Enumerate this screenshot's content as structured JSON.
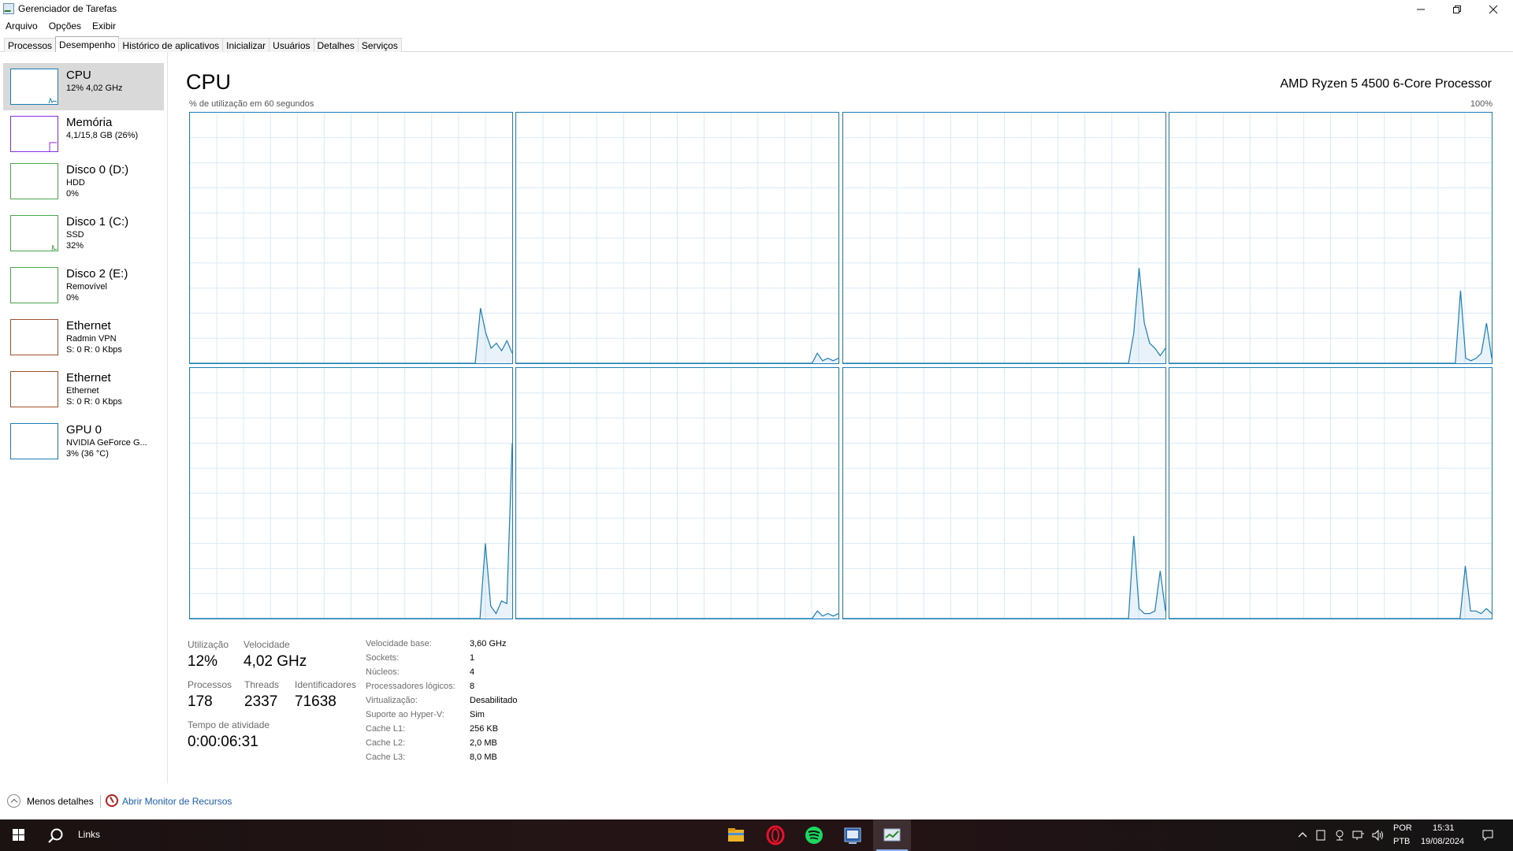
{
  "window": {
    "title": "Gerenciador de Tarefas",
    "minimize_icon": "minimize-icon",
    "maximize_icon": "restore-icon",
    "close_icon": "close-icon"
  },
  "menu": [
    "Arquivo",
    "Opções",
    "Exibir"
  ],
  "tabs": [
    {
      "label": "Processos",
      "active": false
    },
    {
      "label": "Desempenho",
      "active": true
    },
    {
      "label": "Histórico de aplicativos",
      "active": false
    },
    {
      "label": "Inicializar",
      "active": false
    },
    {
      "label": "Usuários",
      "active": false
    },
    {
      "label": "Detalhes",
      "active": false
    },
    {
      "label": "Serviços",
      "active": false
    }
  ],
  "sidebar": {
    "items": [
      {
        "name": "CPU",
        "line1": "12% 4,02 GHz",
        "line2": "",
        "color": "#1a7eb8",
        "selected": true
      },
      {
        "name": "Memória",
        "line1": "4,1/15,8 GB (26%)",
        "line2": "",
        "color": "#8a2be2",
        "selected": false
      },
      {
        "name": "Disco 0 (D:)",
        "line1": "HDD",
        "line2": "0%",
        "color": "#4ca64c",
        "selected": false
      },
      {
        "name": "Disco 1 (C:)",
        "line1": "SSD",
        "line2": "32%",
        "color": "#4ca64c",
        "selected": false
      },
      {
        "name": "Disco 2 (E:)",
        "line1": "Removível",
        "line2": "0%",
        "color": "#4ca64c",
        "selected": false
      },
      {
        "name": "Ethernet",
        "line1": "Radmin VPN",
        "line2": "S: 0 R: 0 Kbps",
        "color": "#a0522d",
        "selected": false
      },
      {
        "name": "Ethernet",
        "line1": "Ethernet",
        "line2": "S: 0 R: 0 Kbps",
        "color": "#a0522d",
        "selected": false
      },
      {
        "name": "GPU 0",
        "line1": "NVIDIA GeForce G...",
        "line2": "3% (36 °C)",
        "color": "#1a7eb8",
        "selected": false
      }
    ]
  },
  "main": {
    "title": "CPU",
    "processor": "AMD Ryzen 5 4500 6-Core Processor",
    "util_label": "% de utilização em 60 segundos",
    "max_label": "100%",
    "graph_color": "#1a7eb8",
    "cores": [
      [
        0,
        0,
        0,
        0,
        0,
        0,
        0,
        0,
        0,
        0,
        0,
        0,
        0,
        0,
        0,
        0,
        0,
        0,
        0,
        0,
        0,
        0,
        0,
        0,
        0,
        0,
        0,
        0,
        0,
        0,
        0,
        0,
        0,
        0,
        0,
        0,
        0,
        0,
        0,
        0,
        0,
        0,
        0,
        0,
        0,
        0,
        0,
        0,
        0,
        0,
        0,
        0,
        0,
        0,
        0,
        22,
        12,
        6,
        8,
        5,
        9,
        4
      ],
      [
        0,
        0,
        0,
        0,
        0,
        0,
        0,
        0,
        0,
        0,
        0,
        0,
        0,
        0,
        0,
        0,
        0,
        0,
        0,
        0,
        0,
        0,
        0,
        0,
        0,
        0,
        0,
        0,
        0,
        0,
        0,
        0,
        0,
        0,
        0,
        0,
        0,
        0,
        0,
        0,
        0,
        0,
        0,
        0,
        0,
        0,
        0,
        0,
        0,
        0,
        0,
        0,
        0,
        0,
        0,
        0,
        0,
        4,
        1,
        2,
        1,
        2
      ],
      [
        0,
        0,
        0,
        0,
        0,
        0,
        0,
        0,
        0,
        0,
        0,
        0,
        0,
        0,
        0,
        0,
        0,
        0,
        0,
        0,
        0,
        0,
        0,
        0,
        0,
        0,
        0,
        0,
        0,
        0,
        0,
        0,
        0,
        0,
        0,
        0,
        0,
        0,
        0,
        0,
        0,
        0,
        0,
        0,
        0,
        0,
        0,
        0,
        0,
        0,
        0,
        0,
        0,
        0,
        0,
        12,
        38,
        16,
        8,
        6,
        3,
        6
      ],
      [
        0,
        0,
        0,
        0,
        0,
        0,
        0,
        0,
        0,
        0,
        0,
        0,
        0,
        0,
        0,
        0,
        0,
        0,
        0,
        0,
        0,
        0,
        0,
        0,
        0,
        0,
        0,
        0,
        0,
        0,
        0,
        0,
        0,
        0,
        0,
        0,
        0,
        0,
        0,
        0,
        0,
        0,
        0,
        0,
        0,
        0,
        0,
        0,
        0,
        0,
        0,
        0,
        0,
        0,
        0,
        0,
        29,
        2,
        1,
        2,
        4,
        16,
        2
      ],
      [
        0,
        0,
        0,
        0,
        0,
        0,
        0,
        0,
        0,
        0,
        0,
        0,
        0,
        0,
        0,
        0,
        0,
        0,
        0,
        0,
        0,
        0,
        0,
        0,
        0,
        0,
        0,
        0,
        0,
        0,
        0,
        0,
        0,
        0,
        0,
        0,
        0,
        0,
        0,
        0,
        0,
        0,
        0,
        0,
        0,
        0,
        0,
        0,
        0,
        0,
        0,
        0,
        0,
        0,
        0,
        30,
        5,
        2,
        7,
        6,
        70
      ],
      [
        0,
        0,
        0,
        0,
        0,
        0,
        0,
        0,
        0,
        0,
        0,
        0,
        0,
        0,
        0,
        0,
        0,
        0,
        0,
        0,
        0,
        0,
        0,
        0,
        0,
        0,
        0,
        0,
        0,
        0,
        0,
        0,
        0,
        0,
        0,
        0,
        0,
        0,
        0,
        0,
        0,
        0,
        0,
        0,
        0,
        0,
        0,
        0,
        0,
        0,
        0,
        0,
        0,
        0,
        0,
        0,
        0,
        3,
        1,
        2,
        1,
        2
      ],
      [
        0,
        0,
        0,
        0,
        0,
        0,
        0,
        0,
        0,
        0,
        0,
        0,
        0,
        0,
        0,
        0,
        0,
        0,
        0,
        0,
        0,
        0,
        0,
        0,
        0,
        0,
        0,
        0,
        0,
        0,
        0,
        0,
        0,
        0,
        0,
        0,
        0,
        0,
        0,
        0,
        0,
        0,
        0,
        0,
        0,
        0,
        0,
        0,
        0,
        0,
        0,
        0,
        0,
        0,
        0,
        33,
        4,
        2,
        2,
        3,
        19,
        3
      ],
      [
        0,
        0,
        0,
        0,
        0,
        0,
        0,
        0,
        0,
        0,
        0,
        0,
        0,
        0,
        0,
        0,
        0,
        0,
        0,
        0,
        0,
        0,
        0,
        0,
        0,
        0,
        0,
        0,
        0,
        0,
        0,
        0,
        0,
        0,
        0,
        0,
        0,
        0,
        0,
        0,
        0,
        0,
        0,
        0,
        0,
        0,
        0,
        0,
        0,
        0,
        0,
        0,
        0,
        0,
        0,
        0,
        21,
        3,
        3,
        2,
        4,
        2
      ]
    ]
  },
  "stats": {
    "util_label": "Utilização",
    "util_value": "12%",
    "speed_label": "Velocidade",
    "speed_value": "4,02 GHz",
    "proc_label": "Processos",
    "proc_value": "178",
    "threads_label": "Threads",
    "threads_value": "2337",
    "handles_label": "Identificadores",
    "handles_value": "71638",
    "uptime_label": "Tempo de atividade",
    "uptime_value": "0:00:06:31"
  },
  "specs": [
    {
      "k": "Velocidade base:",
      "v": "3,60 GHz"
    },
    {
      "k": "Sockets:",
      "v": "1"
    },
    {
      "k": "Núcleos:",
      "v": "4"
    },
    {
      "k": "Processadores lógicos:",
      "v": "8"
    },
    {
      "k": "Virtualização:",
      "v": "Desabilitado"
    },
    {
      "k": "Suporte ao Hyper-V:",
      "v": "Sim"
    },
    {
      "k": "Cache L1:",
      "v": "256 KB"
    },
    {
      "k": "Cache L2:",
      "v": "2,0 MB"
    },
    {
      "k": "Cache L3:",
      "v": "8,0 MB"
    }
  ],
  "footer": {
    "less_details": "Menos detalhes",
    "resource_monitor": "Abrir Monitor de Recursos"
  },
  "taskbar": {
    "search_label": "Links",
    "apps": [
      "file-explorer-icon",
      "opera-icon",
      "spotify-icon",
      "app-icon",
      "task-manager-icon"
    ],
    "lang1": "POR",
    "lang2": "PTB",
    "time": "15:31",
    "date": "19/08/2024"
  }
}
